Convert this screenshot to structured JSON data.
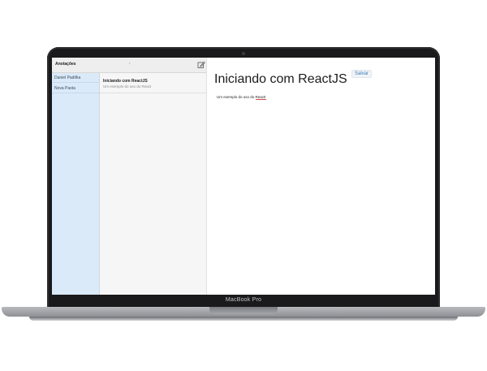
{
  "app": {
    "header_title": "Anotações",
    "header_dot": "•"
  },
  "folders": {
    "items": [
      {
        "label": "Daniel Padilha"
      },
      {
        "label": "Nova Pasta"
      }
    ]
  },
  "notes": {
    "items": [
      {
        "title": "Iniciando com ReactJS",
        "preview": "Um exemplo do uso do React"
      }
    ]
  },
  "editor": {
    "title": "Iniciando com ReactJS",
    "body_prefix": "Um exemplo do uso do ",
    "body_underlined": "React!",
    "save_label": "Salvar"
  },
  "device": {
    "label": "MacBook Pro"
  },
  "colors": {
    "folder_pane": "#dbeaf8",
    "notes_pane": "#f6f6f6",
    "save_accent": "#3d7ab8",
    "laptop_bezel": "#1a1a1c"
  },
  "icons": {
    "compose": "compose-icon"
  }
}
